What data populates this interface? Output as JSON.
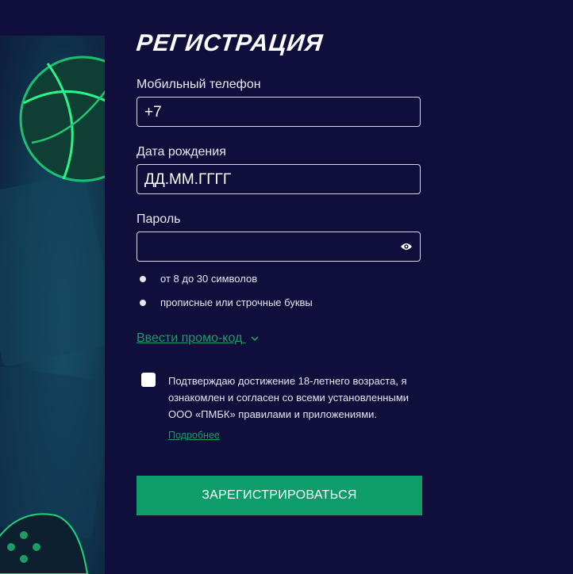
{
  "form": {
    "title": "РЕГИСТРАЦИЯ",
    "phone": {
      "label": "Мобильный телефон",
      "value": "+7"
    },
    "birthdate": {
      "label": "Дата рождения",
      "placeholder": "ДД.ММ.ГГГГ"
    },
    "password": {
      "label": "Пароль",
      "value": "",
      "toggle_icon": "eye-icon"
    },
    "password_rules": [
      "от 8 до 30 символов",
      "прописные или строчные буквы"
    ],
    "promo_link": "Ввести промо-код",
    "consent": {
      "checked": false,
      "text": "Подтверждаю достижение 18-летнего возраста, я ознакомлен и согласен со всеми установленными ООО «ПМБК» правилами и приложениями.",
      "more_link": "Подробнее"
    },
    "submit_label": "ЗАРЕГИСТРИРОВАТЬСЯ"
  },
  "colors": {
    "background": "#100e3a",
    "accent": "#0e9c6a",
    "link": "#1f9a6b",
    "border": "#d8d8e4"
  }
}
